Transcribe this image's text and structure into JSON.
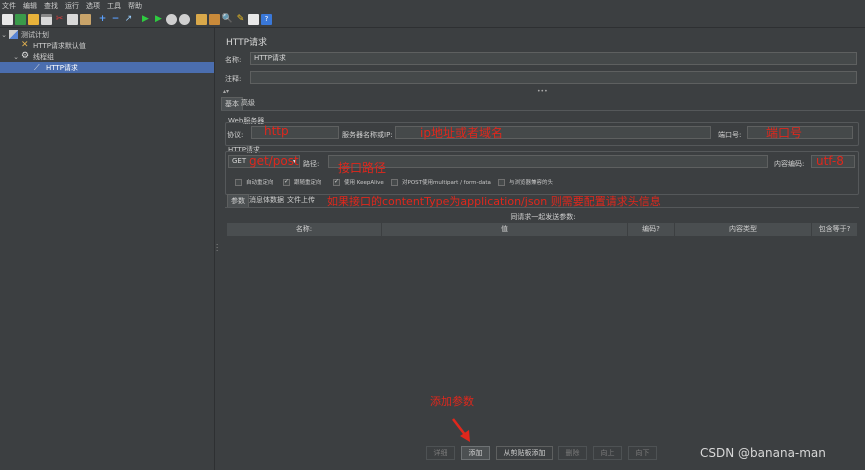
{
  "menu": [
    "文件",
    "编辑",
    "查找",
    "运行",
    "选项",
    "工具",
    "帮助"
  ],
  "toolbar_icons": [
    "new-icon",
    "templates-icon",
    "open-icon",
    "save-icon",
    "cut-icon",
    "copy-icon",
    "paste-icon",
    "expand-icon",
    "collapse-icon",
    "toggle-icon",
    "start-icon",
    "start-no-pause-icon",
    "stop-icon",
    "shutdown-icon",
    "clear-icon",
    "clear-all-icon",
    "search-icon",
    "reset-search-icon",
    "function-helper-icon",
    "help-icon"
  ],
  "tree": {
    "items": [
      {
        "label": "测试计划",
        "icon": "test-plan-icon",
        "expanded": true,
        "indent": 0
      },
      {
        "label": "HTTP请求默认值",
        "icon": "config-icon",
        "indent": 1
      },
      {
        "label": "线程组",
        "icon": "thread-group-icon",
        "expanded": true,
        "indent": 1
      },
      {
        "label": "HTTP请求",
        "icon": "sampler-icon",
        "indent": 2,
        "selected": true
      }
    ]
  },
  "panel": {
    "title": "HTTP请求",
    "name_label": "名称:",
    "name_value": "HTTP请求",
    "comment_label": "注释:",
    "comment_value": "",
    "tabs": [
      "基本",
      "高级"
    ],
    "web_server": {
      "legend": "Web服务器",
      "protocol_label": "协议:",
      "protocol_value": "",
      "server_label": "服务器名称或IP:",
      "server_value": "",
      "port_label": "端口号:",
      "port_value": ""
    },
    "http_request": {
      "legend": "HTTP请求",
      "method_value": "GET",
      "path_label": "路径:",
      "path_value": "",
      "encoding_label": "内容编码:",
      "encoding_value": ""
    },
    "checkboxes": [
      {
        "label": "自动重定向",
        "checked": false
      },
      {
        "label": "跟随重定向",
        "checked": true
      },
      {
        "label": "使用 KeepAlive",
        "checked": true
      },
      {
        "label": "对POST使用multipart / form-data",
        "checked": false
      },
      {
        "label": "与浏览器兼容的头",
        "checked": false
      }
    ],
    "param_tabs": [
      "参数",
      "消息体数据",
      "文件上传"
    ],
    "table": {
      "caption": "同请求一起发送参数:",
      "headers": [
        "名称:",
        "值",
        "编码?",
        "内容类型",
        "包含等于?"
      ]
    },
    "buttons": [
      {
        "label": "详细",
        "state": "disabled"
      },
      {
        "label": "添加",
        "state": "active"
      },
      {
        "label": "从剪贴板添加",
        "state": "normal"
      },
      {
        "label": "删除",
        "state": "disabled"
      },
      {
        "label": "向上",
        "state": "disabled"
      },
      {
        "label": "向下",
        "state": "disabled"
      }
    ]
  },
  "annotations": {
    "protocol": "http",
    "server": "ip地址或者域名",
    "port": "端口号",
    "method": "get/post",
    "path": "接口路径",
    "encoding": "utf-8",
    "content_type_note": "如果接口的contentType为application/json 则需要配置请求头信息",
    "add_params": "添加参数",
    "color": "#e0271c"
  },
  "watermark": "CSDN @banana-man"
}
